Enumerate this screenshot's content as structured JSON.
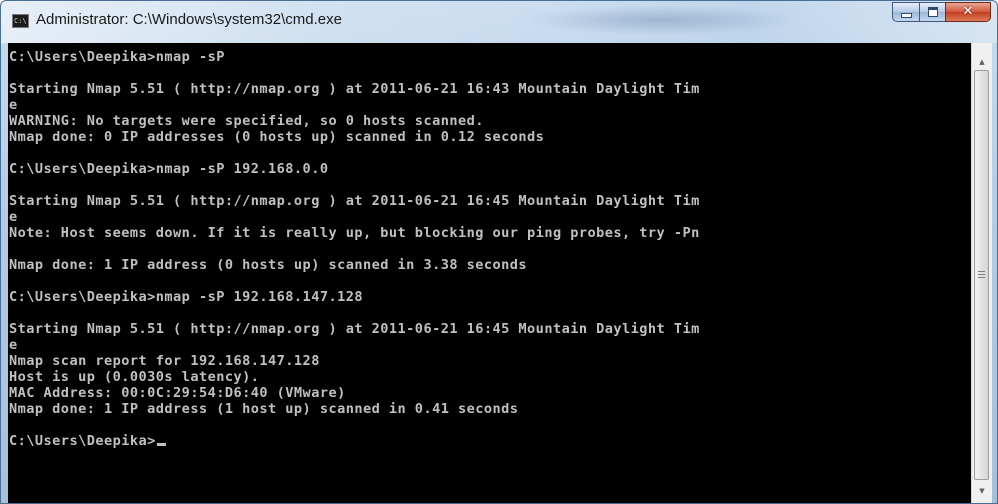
{
  "window": {
    "title": "Administrator: C:\\Windows\\system32\\cmd.exe",
    "app_icon_text": "C:\\",
    "close_glyph": "✕",
    "colors": {
      "console_background": "#000000",
      "console_text": "#c0c0c0",
      "titlebar": "#b9d1ea",
      "close_button": "#c8462a"
    }
  },
  "console": {
    "lines": [
      "C:\\Users\\Deepika>nmap -sP",
      "",
      "Starting Nmap 5.51 ( http://nmap.org ) at 2011-06-21 16:43 Mountain Daylight Tim",
      "e",
      "WARNING: No targets were specified, so 0 hosts scanned.",
      "Nmap done: 0 IP addresses (0 hosts up) scanned in 0.12 seconds",
      "",
      "C:\\Users\\Deepika>nmap -sP 192.168.0.0",
      "",
      "Starting Nmap 5.51 ( http://nmap.org ) at 2011-06-21 16:45 Mountain Daylight Tim",
      "e",
      "Note: Host seems down. If it is really up, but blocking our ping probes, try -Pn",
      "",
      "Nmap done: 1 IP address (0 hosts up) scanned in 3.38 seconds",
      "",
      "C:\\Users\\Deepika>nmap -sP 192.168.147.128",
      "",
      "Starting Nmap 5.51 ( http://nmap.org ) at 2011-06-21 16:45 Mountain Daylight Tim",
      "e",
      "Nmap scan report for 192.168.147.128",
      "Host is up (0.0030s latency).",
      "MAC Address: 00:0C:29:54:D6:40 (VMware)",
      "Nmap done: 1 IP address (1 host up) scanned in 0.41 seconds",
      "",
      "C:\\Users\\Deepika>"
    ]
  },
  "scrollbar": {
    "up_arrow": "▲",
    "down_arrow": "▼"
  }
}
